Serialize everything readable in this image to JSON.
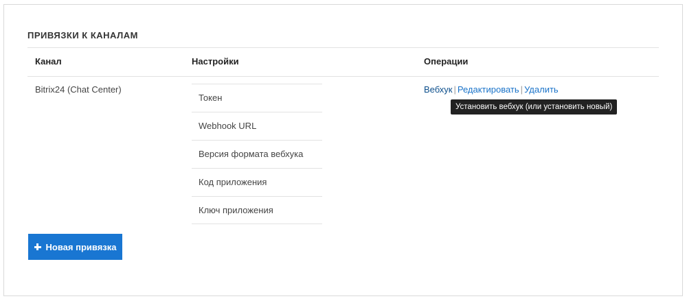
{
  "section": {
    "title": "ПРИВЯЗКИ К КАНАЛАМ"
  },
  "table": {
    "headers": {
      "channel": "Канал",
      "settings": "Настройки",
      "operations": "Операции"
    },
    "rows": [
      {
        "channel": "Bitrix24 (Chat Center)",
        "settings": [
          "Токен",
          "Webhook URL",
          "Версия формата вебхука",
          "Код приложения",
          "Ключ приложения"
        ],
        "operations": {
          "webhook": "Вебхук",
          "edit": "Редактировать",
          "delete": "Удалить",
          "separator": "|"
        }
      }
    ]
  },
  "tooltip": {
    "text": "Установить вебхук (или установить новый)"
  },
  "actions": {
    "new_binding_label": "Новая привязка",
    "new_binding_icon": "plus-icon"
  },
  "colors": {
    "link": "#1a73c9",
    "button_bg": "#1976d2",
    "tooltip_bg": "#222222"
  }
}
